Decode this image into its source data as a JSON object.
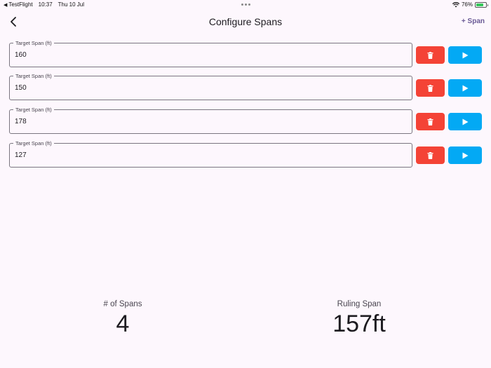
{
  "status_bar": {
    "back_app": "TestFlight",
    "time": "10:37",
    "date": "Thu 10 Jul",
    "battery": "76%",
    "battery_level": 0.76,
    "icons": [
      "wifi-icon",
      "battery-icon",
      "charging-icon"
    ]
  },
  "app_bar": {
    "title": "Configure Spans",
    "add_label": "+ Span",
    "accent": "#6a5a96"
  },
  "spans": [
    {
      "label": "Target Span (ft)",
      "value": "160"
    },
    {
      "label": "Target Span (ft)",
      "value": "150"
    },
    {
      "label": "Target Span (ft)",
      "value": "178"
    },
    {
      "label": "Target Span (ft)",
      "value": "127"
    }
  ],
  "colors": {
    "delete": "#f44336",
    "play": "#03a9f4",
    "background": "#fdf7fd"
  },
  "stats": {
    "count_label": "# of Spans",
    "count_value": "4",
    "ruling_label": "Ruling Span",
    "ruling_value": "157ft"
  }
}
